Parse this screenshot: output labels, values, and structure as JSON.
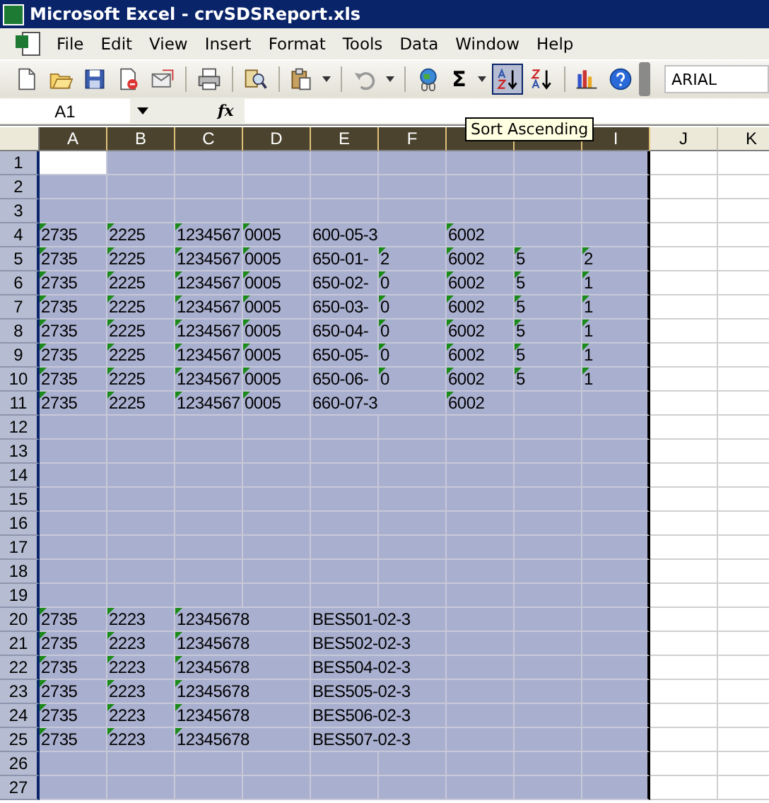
{
  "window": {
    "title": "Microsoft Excel - crvSDSReport.xls"
  },
  "menu": [
    {
      "label": "File"
    },
    {
      "label": "Edit"
    },
    {
      "label": "View"
    },
    {
      "label": "Insert"
    },
    {
      "label": "Format"
    },
    {
      "label": "Tools"
    },
    {
      "label": "Data"
    },
    {
      "label": "Window"
    },
    {
      "label": "Help"
    }
  ],
  "toolbar": {
    "buttons": [
      {
        "kind": "new",
        "highlighted": false
      },
      {
        "kind": "open",
        "highlighted": false
      },
      {
        "kind": "save",
        "highlighted": false
      },
      {
        "kind": "permission",
        "highlighted": false
      },
      {
        "kind": "email",
        "highlighted": false
      },
      {
        "kind": "sep"
      },
      {
        "kind": "print",
        "highlighted": false
      },
      {
        "kind": "sep"
      },
      {
        "kind": "research",
        "highlighted": false
      },
      {
        "kind": "sep"
      },
      {
        "kind": "paste",
        "highlighted": false
      },
      {
        "kind": "drop"
      },
      {
        "kind": "sep"
      },
      {
        "kind": "undo",
        "highlighted": false
      },
      {
        "kind": "drop"
      },
      {
        "kind": "sep"
      },
      {
        "kind": "hyperlink",
        "highlighted": false
      },
      {
        "kind": "sum",
        "highlighted": false,
        "text": "Σ"
      },
      {
        "kind": "drop"
      },
      {
        "kind": "sortasc",
        "highlighted": true
      },
      {
        "kind": "sortdesc",
        "highlighted": false
      },
      {
        "kind": "sep"
      },
      {
        "kind": "chart",
        "highlighted": false
      },
      {
        "kind": "help",
        "highlighted": false
      }
    ],
    "font": "ARIAL"
  },
  "tooltip": "Sort Ascending",
  "formula_bar": {
    "name_box": "A1",
    "fx": "fx"
  },
  "columns": [
    {
      "label": "A",
      "selected": true
    },
    {
      "label": "B",
      "selected": true
    },
    {
      "label": "C",
      "selected": true
    },
    {
      "label": "D",
      "selected": true
    },
    {
      "label": "E",
      "selected": true
    },
    {
      "label": "F",
      "selected": true
    },
    {
      "selected": true
    },
    {
      "selected": true
    },
    {
      "label": "I",
      "selected": true
    },
    {
      "label": "J",
      "selected": false
    },
    {
      "label": "K",
      "selected": false
    }
  ],
  "rows": [
    {
      "header": "1",
      "selected": true,
      "cells": [
        {
          "active": true
        }
      ]
    },
    {
      "header": "2",
      "selected": true
    },
    {
      "header": "3",
      "selected": true
    },
    {
      "header": "4",
      "selected": true,
      "cells": [
        {
          "text": "2735",
          "flag": true
        },
        {
          "text": "2225",
          "flag": true
        },
        {
          "text": "1234567",
          "flag": true
        },
        {
          "text": "0005",
          "flag": true
        },
        {
          "text": "600-05-3",
          "flag": false
        },
        {},
        {
          "text": "6002",
          "flag": true
        }
      ]
    },
    {
      "header": "5",
      "selected": true,
      "cells": [
        {
          "text": "2735",
          "flag": true
        },
        {
          "text": "2225",
          "flag": true
        },
        {
          "text": "1234567",
          "flag": true
        },
        {
          "text": "0005",
          "flag": true
        },
        {
          "text": "650-01-",
          "flag": false
        },
        {
          "text": "2",
          "flag": true
        },
        {
          "text": "6002",
          "flag": true
        },
        {
          "text": "5",
          "flag": true
        },
        {
          "text": "2",
          "flag": true
        }
      ]
    },
    {
      "header": "6",
      "selected": true,
      "cells": [
        {
          "text": "2735",
          "flag": true
        },
        {
          "text": "2225",
          "flag": true
        },
        {
          "text": "1234567",
          "flag": true
        },
        {
          "text": "0005",
          "flag": true
        },
        {
          "text": "650-02-",
          "flag": false
        },
        {
          "text": "0",
          "flag": true
        },
        {
          "text": "6002",
          "flag": true
        },
        {
          "text": "5",
          "flag": true
        },
        {
          "text": "1",
          "flag": true
        }
      ]
    },
    {
      "header": "7",
      "selected": true,
      "cells": [
        {
          "text": "2735",
          "flag": true
        },
        {
          "text": "2225",
          "flag": true
        },
        {
          "text": "1234567",
          "flag": true
        },
        {
          "text": "0005",
          "flag": true
        },
        {
          "text": "650-03-",
          "flag": false
        },
        {
          "text": "0",
          "flag": true
        },
        {
          "text": "6002",
          "flag": true
        },
        {
          "text": "5",
          "flag": true
        },
        {
          "text": "1",
          "flag": true
        }
      ]
    },
    {
      "header": "8",
      "selected": true,
      "cells": [
        {
          "text": "2735",
          "flag": true
        },
        {
          "text": "2225",
          "flag": true
        },
        {
          "text": "1234567",
          "flag": true
        },
        {
          "text": "0005",
          "flag": true
        },
        {
          "text": "650-04-",
          "flag": false
        },
        {
          "text": "0",
          "flag": true
        },
        {
          "text": "6002",
          "flag": true
        },
        {
          "text": "5",
          "flag": true
        },
        {
          "text": "1",
          "flag": true
        }
      ]
    },
    {
      "header": "9",
      "selected": true,
      "cells": [
        {
          "text": "2735",
          "flag": true
        },
        {
          "text": "2225",
          "flag": true
        },
        {
          "text": "1234567",
          "flag": true
        },
        {
          "text": "0005",
          "flag": true
        },
        {
          "text": "650-05-",
          "flag": false
        },
        {
          "text": "0",
          "flag": true
        },
        {
          "text": "6002",
          "flag": true
        },
        {
          "text": "5",
          "flag": true
        },
        {
          "text": "1",
          "flag": true
        }
      ]
    },
    {
      "header": "10",
      "selected": true,
      "cells": [
        {
          "text": "2735",
          "flag": true
        },
        {
          "text": "2225",
          "flag": true
        },
        {
          "text": "1234567",
          "flag": true
        },
        {
          "text": "0005",
          "flag": true
        },
        {
          "text": "650-06-",
          "flag": false
        },
        {
          "text": "0",
          "flag": true
        },
        {
          "text": "6002",
          "flag": true
        },
        {
          "text": "5",
          "flag": true
        },
        {
          "text": "1",
          "flag": true
        }
      ]
    },
    {
      "header": "11",
      "selected": true,
      "cells": [
        {
          "text": "2735",
          "flag": true
        },
        {
          "text": "2225",
          "flag": true
        },
        {
          "text": "1234567",
          "flag": true
        },
        {
          "text": "0005",
          "flag": true
        },
        {
          "text": "660-07-3",
          "flag": false
        },
        {},
        {
          "text": "6002",
          "flag": true
        }
      ]
    },
    {
      "header": "12",
      "selected": true
    },
    {
      "header": "13",
      "selected": true
    },
    {
      "header": "14",
      "selected": true
    },
    {
      "header": "15",
      "selected": true
    },
    {
      "header": "16",
      "selected": true
    },
    {
      "header": "17",
      "selected": true
    },
    {
      "header": "18",
      "selected": true
    },
    {
      "header": "19",
      "selected": true
    },
    {
      "header": "20",
      "selected": true,
      "cells": [
        {
          "text": "2735",
          "flag": true
        },
        {
          "text": "2223",
          "flag": true
        },
        {
          "text": "12345678",
          "flag": true
        },
        {},
        {
          "text": "BES501-02-3",
          "flag": false
        }
      ]
    },
    {
      "header": "21",
      "selected": true,
      "cells": [
        {
          "text": "2735",
          "flag": true
        },
        {
          "text": "2223",
          "flag": true
        },
        {
          "text": "12345678",
          "flag": true
        },
        {},
        {
          "text": "BES502-02-3",
          "flag": false
        }
      ]
    },
    {
      "header": "22",
      "selected": true,
      "cells": [
        {
          "text": "2735",
          "flag": true
        },
        {
          "text": "2223",
          "flag": true
        },
        {
          "text": "12345678",
          "flag": true
        },
        {},
        {
          "text": "BES504-02-3",
          "flag": false
        }
      ]
    },
    {
      "header": "23",
      "selected": true,
      "cells": [
        {
          "text": "2735",
          "flag": true
        },
        {
          "text": "2223",
          "flag": true
        },
        {
          "text": "12345678",
          "flag": true
        },
        {},
        {
          "text": "BES505-02-3",
          "flag": false
        }
      ]
    },
    {
      "header": "24",
      "selected": true,
      "cells": [
        {
          "text": "2735",
          "flag": true
        },
        {
          "text": "2223",
          "flag": true
        },
        {
          "text": "12345678",
          "flag": true
        },
        {},
        {
          "text": "BES506-02-3",
          "flag": false
        }
      ]
    },
    {
      "header": "25",
      "selected": true,
      "cells": [
        {
          "text": "2735",
          "flag": true
        },
        {
          "text": "2223",
          "flag": true
        },
        {
          "text": "12345678",
          "flag": true
        },
        {},
        {
          "text": "BES507-02-3",
          "flag": false
        }
      ]
    },
    {
      "header": "26",
      "selected": true
    },
    {
      "header": "27",
      "selected": true
    }
  ]
}
